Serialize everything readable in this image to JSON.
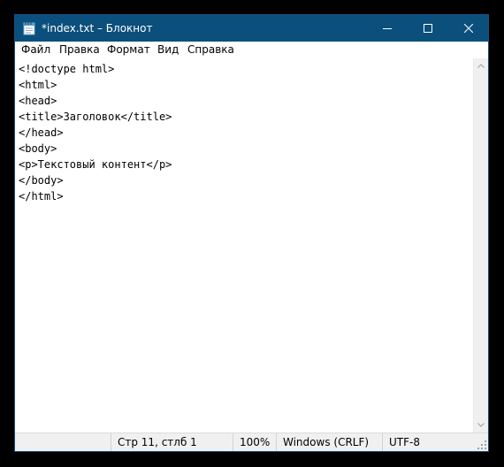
{
  "window": {
    "title": "*index.txt – Блокнот",
    "app_icon": "notepad-icon",
    "buttons": {
      "minimize_icon": "minimize-icon",
      "maximize_icon": "maximize-icon",
      "close_icon": "close-icon"
    }
  },
  "menu": {
    "items": [
      "Файл",
      "Правка",
      "Формат",
      "Вид",
      "Справка"
    ]
  },
  "editor": {
    "lines": [
      "<!doctype html>",
      "<html>",
      "<head>",
      "<title>Заголовок</title>",
      "</head>",
      "<body>",
      "<p>Текстовый контент</p>",
      "</body>",
      "</html>"
    ]
  },
  "status": {
    "position": "Стр 11, стлб 1",
    "zoom": "100%",
    "line_endings": "Windows (CRLF)",
    "encoding": "UTF-8"
  },
  "colors": {
    "titlebar": "#0b4f7c",
    "background": "#000000",
    "statusbar": "#f0f0f0"
  }
}
